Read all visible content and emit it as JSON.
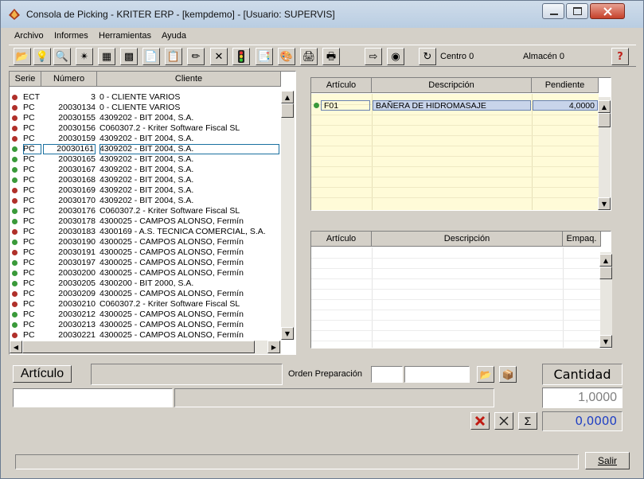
{
  "window": {
    "title": "Consola de Picking - KRITER ERP - [kempdemo] - [Usuario: SUPERVIS]"
  },
  "menu": [
    "Archivo",
    "Informes",
    "Herramientas",
    "Ayuda"
  ],
  "toolbar": {
    "centro_label": "Centro 0",
    "almacen_label": "Almacén 0",
    "icons": [
      "open-folder-icon",
      "lightbulb-icon",
      "preview-icon",
      "tools-icon",
      "grid-icon",
      "table-icon",
      "copy-doc-icon",
      "paste-doc-icon",
      "eraser-icon",
      "delete-x-icon",
      "traffic-light-icon",
      "documents-icon",
      "colors-icon",
      "printer-icon",
      "printer2-icon",
      "export-icon",
      "stamp-icon",
      "refresh-icon",
      "help-icon"
    ]
  },
  "orders": {
    "columns": [
      "Serie",
      "Número",
      "Cliente"
    ],
    "rows": [
      {
        "status": "red",
        "serie": "ECT",
        "numero": "3",
        "cliente": "0 - CLIENTE VARIOS"
      },
      {
        "status": "red",
        "serie": "PC",
        "numero": "20030134",
        "cliente": "0 - CLIENTE VARIOS"
      },
      {
        "status": "red",
        "serie": "PC",
        "numero": "20030155",
        "cliente": "4309202 - BIT 2004, S.A."
      },
      {
        "status": "red",
        "serie": "PC",
        "numero": "20030156",
        "cliente": "C060307.2 - Kriter Software Fiscal SL"
      },
      {
        "status": "red",
        "serie": "PC",
        "numero": "20030159",
        "cliente": "4309202 - BIT 2004, S.A."
      },
      {
        "status": "green",
        "serie": "PC",
        "numero": "20030161",
        "cliente": "4309202 - BIT 2004, S.A.",
        "selected": true
      },
      {
        "status": "green",
        "serie": "PC",
        "numero": "20030165",
        "cliente": "4309202 - BIT 2004, S.A."
      },
      {
        "status": "green",
        "serie": "PC",
        "numero": "20030167",
        "cliente": "4309202 - BIT 2004, S.A."
      },
      {
        "status": "green",
        "serie": "PC",
        "numero": "20030168",
        "cliente": "4309202 - BIT 2004, S.A."
      },
      {
        "status": "red",
        "serie": "PC",
        "numero": "20030169",
        "cliente": "4309202 - BIT 2004, S.A."
      },
      {
        "status": "red",
        "serie": "PC",
        "numero": "20030170",
        "cliente": "4309202 - BIT 2004, S.A."
      },
      {
        "status": "green",
        "serie": "PC",
        "numero": "20030176",
        "cliente": "C060307.2 - Kriter Software Fiscal SL"
      },
      {
        "status": "green",
        "serie": "PC",
        "numero": "20030178",
        "cliente": "4300025 - CAMPOS ALONSO, Fermín"
      },
      {
        "status": "red",
        "serie": "PC",
        "numero": "20030183",
        "cliente": "4300169 - A.S. TECNICA COMERCIAL, S.A."
      },
      {
        "status": "green",
        "serie": "PC",
        "numero": "20030190",
        "cliente": "4300025 - CAMPOS ALONSO, Fermín"
      },
      {
        "status": "red",
        "serie": "PC",
        "numero": "20030191",
        "cliente": "4300025 - CAMPOS ALONSO, Fermín"
      },
      {
        "status": "green",
        "serie": "PC",
        "numero": "20030197",
        "cliente": "4300025 - CAMPOS ALONSO, Fermín"
      },
      {
        "status": "green",
        "serie": "PC",
        "numero": "20030200",
        "cliente": "4300025 - CAMPOS ALONSO, Fermín"
      },
      {
        "status": "green",
        "serie": "PC",
        "numero": "20030205",
        "cliente": "4300200 - BIT 2000, S.A."
      },
      {
        "status": "red",
        "serie": "PC",
        "numero": "20030209",
        "cliente": "4300025 - CAMPOS ALONSO, Fermín"
      },
      {
        "status": "red",
        "serie": "PC",
        "numero": "20030210",
        "cliente": "C060307.2 - Kriter Software Fiscal SL"
      },
      {
        "status": "green",
        "serie": "PC",
        "numero": "20030212",
        "cliente": "4300025 - CAMPOS ALONSO, Fermín"
      },
      {
        "status": "green",
        "serie": "PC",
        "numero": "20030213",
        "cliente": "4300025 - CAMPOS ALONSO, Fermín"
      },
      {
        "status": "red",
        "serie": "PC",
        "numero": "20030221",
        "cliente": "4300025 - CAMPOS ALONSO, Fermín"
      }
    ]
  },
  "order_lines": {
    "columns": [
      "Artículo",
      "Descripción",
      "Pendiente"
    ],
    "rows": [
      {
        "articulo": "F01",
        "descripcion": "BAÑERA DE HIDROMASAJE",
        "pendiente": "4,0000"
      }
    ]
  },
  "packaging": {
    "columns": [
      "Artículo",
      "Descripción",
      "Empaq."
    ]
  },
  "bottom": {
    "articulo_button": "Artículo",
    "orden_label": "Orden Preparación",
    "cantidad_label": "Cantidad",
    "cantidad_value": "1,0000",
    "total_value": "0,0000",
    "sigma": "Σ",
    "salir_button": "Salir"
  },
  "colors": {
    "dot_red": "#b0302a",
    "dot_green": "#3a9a3a",
    "line_bg": "#fffbd8",
    "total_blue": "#1f3fc4"
  }
}
